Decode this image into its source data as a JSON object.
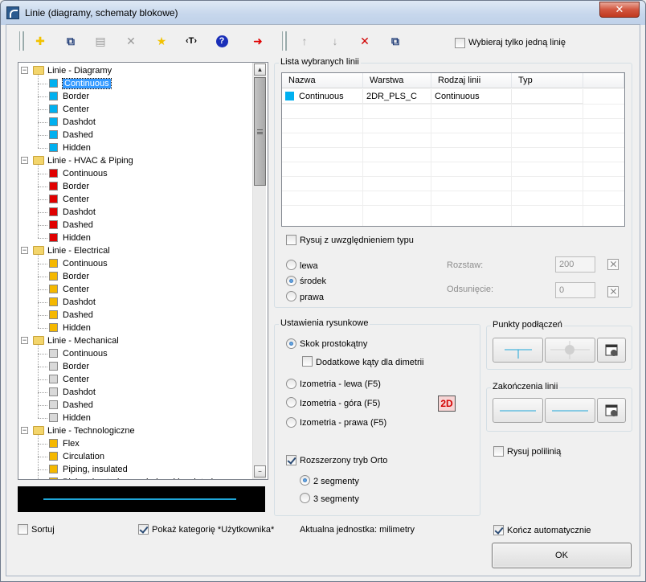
{
  "window": {
    "title": "Linie (diagramy, schematy blokowe)",
    "close_label": "✕"
  },
  "toolbar": {
    "buttons": [
      {
        "name": "add-icon",
        "glyph": "✚",
        "color": "#f2c200"
      },
      {
        "name": "copy-icon",
        "glyph": "⧉",
        "color": "#24407a"
      },
      {
        "name": "properties-icon",
        "glyph": "▤",
        "color": "#9a9a9a"
      },
      {
        "name": "delete-icon",
        "glyph": "✕",
        "color": "#9a9a9a"
      },
      {
        "name": "favorite-star-icon",
        "glyph": "★",
        "color": "#f2c200"
      },
      {
        "name": "text-icon",
        "glyph": "‹T›",
        "color": "#000000"
      },
      {
        "name": "help-icon",
        "glyph": "?",
        "color": "#1a2fb8"
      },
      {
        "name": "transfer-arrow-icon",
        "glyph": "➜",
        "color": "#e00000"
      }
    ],
    "right_buttons": [
      {
        "name": "move-up-icon",
        "glyph": "↑",
        "color": "#a0a0a0"
      },
      {
        "name": "move-down-icon",
        "glyph": "↓",
        "color": "#a0a0a0"
      },
      {
        "name": "remove-red-icon",
        "glyph": "✕",
        "color": "#d00000"
      },
      {
        "name": "duplicate-icon",
        "glyph": "⧉",
        "color": "#24407a"
      }
    ],
    "single_line_label": "Wybieraj tylko jedną linię"
  },
  "tree": {
    "groups": [
      {
        "label": "Linie - Diagramy",
        "color": "#00b0f0",
        "items": [
          "Continuous",
          "Border",
          "Center",
          "Dashdot",
          "Dashed",
          "Hidden"
        ]
      },
      {
        "label": "Linie - HVAC & Piping",
        "color": "#e00000",
        "items": [
          "Continuous",
          "Border",
          "Center",
          "Dashdot",
          "Dashed",
          "Hidden"
        ]
      },
      {
        "label": "Linie - Electrical",
        "color": "#f5b800",
        "items": [
          "Continuous",
          "Border",
          "Center",
          "Dashdot",
          "Dashed",
          "Hidden"
        ]
      },
      {
        "label": "Linie - Mechanical",
        "color": "#d9d9d9",
        "items": [
          "Continuous",
          "Border",
          "Center",
          "Dashdot",
          "Dashed",
          "Hidden"
        ]
      },
      {
        "label": "Linie - Technologiczne",
        "color": "#f5b800",
        "items": [
          "Flex",
          "Circulation",
          "Piping, insulated",
          "Piping, heated or cooled and insulated"
        ]
      }
    ],
    "collapse_glyph": "−"
  },
  "bottom_left": {
    "sort_label": "Sortuj",
    "show_user_label": "Pokaż kategorię *Użytkownika*",
    "unit_label": "Aktualna jednostka: milimetry"
  },
  "selected_list": {
    "legend": "Lista wybranych linii",
    "columns": [
      "Nazwa",
      "Warstwa",
      "Rodzaj linii",
      "Typ"
    ],
    "row": {
      "name": "Continuous",
      "layer": "2DR_PLS_C",
      "kind": "Continuous",
      "type": "",
      "color": "#00b0f0"
    },
    "draw_with_type_label": "Rysuj z uwzględnieniem typu",
    "pos_left": "lewa",
    "pos_center": "środek",
    "pos_right": "prawa",
    "spacing_label": "Rozstaw:",
    "spacing_value": "200",
    "offset_label": "Odsunięcie:",
    "offset_value": "0"
  },
  "drawing": {
    "legend": "Ustawienia rysunkowe",
    "right_step": "Skok prostokątny",
    "dimetric": "Dodatkowe kąty dla dimetrii",
    "iso_left": "Izometria - lewa (F5)",
    "iso_top": "Izometria - góra (F5)",
    "iso_right": "Izometria - prawa (F5)",
    "badge": "2D",
    "ortho": "Rozszerzony tryb Orto",
    "seg2": "2 segmenty",
    "seg3": "3 segmenty"
  },
  "connection": {
    "legend": "Punkty podłączeń"
  },
  "endings": {
    "legend": "Zakończenia linii"
  },
  "right_bottom": {
    "polyline_label": "Rysuj polilinią",
    "auto_finish_label": "Kończ automatycznie",
    "ok_label": "OK"
  }
}
